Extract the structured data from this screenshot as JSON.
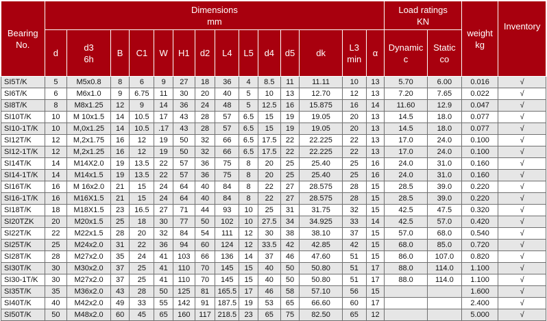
{
  "header": {
    "bearing": "Bearing\nNo.",
    "dimensions": "Dimensions\nmm",
    "load_ratings": "Load ratings\nKN",
    "weight": "weight\nkg",
    "inventory": "Inventory",
    "cols": {
      "d": "d",
      "d3": "d3",
      "d3_sub": "6h",
      "B": "B",
      "C1": "C1",
      "W": "W",
      "H1": "H1",
      "d2": "d2",
      "L4": "L4",
      "L5": "L5",
      "d4": "d4",
      "d5": "d5",
      "dk": "dk",
      "L3": "L3",
      "L3_sub": "min",
      "alpha": "α",
      "dynamic": "Dynamic\nc",
      "static": "Static\nco"
    }
  },
  "rows": [
    [
      "SI5T/K",
      "5",
      "M5x0.8",
      "8",
      "6",
      "9",
      "27",
      "18",
      "36",
      "4",
      "8.5",
      "11",
      "11.11",
      "10",
      "13",
      "5.70",
      "6.00",
      "0.016",
      "√"
    ],
    [
      "SI6T/K",
      "6",
      "M6x1.0",
      "9",
      "6.75",
      "11",
      "30",
      "20",
      "40",
      "5",
      "10",
      "13",
      "12.70",
      "12",
      "13",
      "7.20",
      "7.65",
      "0.022",
      "√"
    ],
    [
      "SI8T/K",
      "8",
      "M8x1.25",
      "12",
      "9",
      "14",
      "36",
      "24",
      "48",
      "5",
      "12.5",
      "16",
      "15.875",
      "16",
      "14",
      "11.60",
      "12.9",
      "0.047",
      "√"
    ],
    [
      "SI10T/K",
      "10",
      "M 10x1.5",
      "14",
      "10.5",
      "17",
      "43",
      "28",
      "57",
      "6.5",
      "15",
      "19",
      "19.05",
      "20",
      "13",
      "14.5",
      "18.0",
      "0.077",
      "√"
    ],
    [
      "SI10-1T/K",
      "10",
      "M,0x1.25",
      "14",
      "10.5",
      ".17",
      "43",
      "28",
      "57",
      "6.5",
      "15",
      "19",
      "19.05",
      "20",
      "13",
      "14.5",
      "18.0",
      "0.077",
      "√"
    ],
    [
      "SI12T/K",
      "12",
      "M,2x1.75",
      "16",
      "12",
      "19",
      "50",
      "32",
      "66",
      "6.5",
      "17.5",
      "22",
      "22.225",
      "22",
      "13",
      "17.0",
      "24.0",
      "0.100",
      "√"
    ],
    [
      "SI12-1T/K",
      "12",
      "M,2x1.25",
      "16",
      "12",
      "19",
      "50",
      "32",
      "66",
      "6.5",
      "17.5",
      "22",
      "22.225",
      "22",
      "13",
      "17.0",
      "24.0",
      "0.100",
      "√"
    ],
    [
      "SI14T/K",
      "14",
      "M14X2.0",
      "19",
      "13.5",
      "22",
      "57",
      "36",
      "75",
      "8",
      "20",
      "25",
      "25.40",
      "25",
      "16",
      "24.0",
      "31.0",
      "0.160",
      "√"
    ],
    [
      "SI14-1T/K",
      "14",
      "M14x1.5",
      "19",
      "13.5",
      "22",
      "57",
      "36",
      "75",
      "8",
      "20",
      "25",
      "25.40",
      "25",
      "16",
      "24.0",
      "31.0",
      "0.160",
      "√"
    ],
    [
      "SI16T/K",
      "16",
      "M 16x2.0",
      "21",
      "15",
      "24",
      "64",
      "40",
      "84",
      "8",
      "22",
      "27",
      "28.575",
      "28",
      "15",
      "28.5",
      "39.0",
      "0.220",
      "√"
    ],
    [
      "SI16-1T/K",
      "16",
      "M16X1.5",
      "21",
      "15",
      "24",
      "64",
      "40",
      "84",
      "8",
      "22",
      "27",
      "28.575",
      "28",
      "15",
      "28.5",
      "39.0",
      "0.220",
      "√"
    ],
    [
      "SI18T/K",
      "18",
      "M18X1.5",
      "23",
      "16.5",
      "27",
      "71",
      "44",
      "93",
      "10",
      "25",
      "31",
      "31.75",
      "32",
      "15",
      "42.5",
      "47.5",
      "0.320",
      "√"
    ],
    [
      "SI20TZK",
      "20",
      "M20x1.5",
      "25",
      "18",
      "30",
      "77",
      "50",
      "102",
      "10",
      "27.5",
      "34",
      "34.925",
      "33",
      "14",
      "42.5",
      "57.0",
      "0.420",
      "√"
    ],
    [
      "SI22T/K",
      "22",
      "M22x1.5",
      "28",
      "20",
      "32",
      "84",
      "54",
      "111",
      "12",
      "30",
      "38",
      "38.10",
      "37",
      "15",
      "57.0",
      "68.0",
      "0.540",
      "√"
    ],
    [
      "SI25T/K",
      "25",
      "M24x2.0",
      "31",
      "22",
      "36",
      "94",
      "60",
      "124",
      "12",
      "33.5",
      "42",
      "42.85",
      "42",
      "15",
      "68.0",
      "85.0",
      "0.720",
      "√"
    ],
    [
      "SI28T/K",
      "28",
      "M27x2.0",
      "35",
      "24",
      "41",
      "103",
      "66",
      "136",
      "14",
      "37",
      "46",
      "47.60",
      "51",
      "15",
      "86.0",
      "107.0",
      "0.820",
      "√"
    ],
    [
      "SI30T/K",
      "30",
      "M30x2.0",
      "37",
      "25",
      "41",
      "110",
      "70",
      "145",
      "15",
      "40",
      "50",
      "50.80",
      "51",
      "17",
      "88.0",
      "114.0",
      "1.100",
      "√"
    ],
    [
      "SI30-1T/K",
      "30",
      "M27x2.0",
      "37",
      "25",
      "41",
      "110",
      "70",
      "145",
      "15",
      "40",
      "50",
      "50.80",
      "51",
      "17",
      "88.0",
      "114.0",
      "1.100",
      "√"
    ],
    [
      "SI35T/K",
      "35",
      "M36x2.0",
      "43",
      "28",
      "50",
      "125",
      "81",
      "165.5",
      "17",
      "46",
      "58",
      "57.10",
      "56",
      "15",
      "",
      "",
      "1.600",
      "√"
    ],
    [
      "SI40T/K",
      "40",
      "M42x2.0",
      "49",
      "33",
      "55",
      "142",
      "91",
      "187.5",
      "19",
      "53",
      "65",
      "66.60",
      "60",
      "17",
      "",
      "",
      "2.400",
      "√"
    ],
    [
      "SI50T/K",
      "50",
      "M48x2.0",
      "60",
      "45",
      "65",
      "160",
      "117",
      "218.5",
      "23",
      "65",
      "75",
      "82.50",
      "65",
      "12",
      "",
      "",
      "5.000",
      "√"
    ]
  ]
}
